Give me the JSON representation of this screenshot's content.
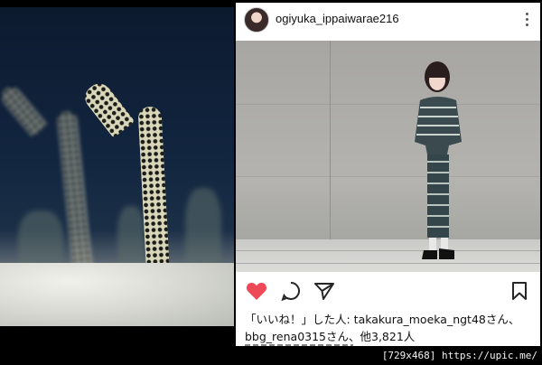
{
  "post": {
    "username": "ogiyuka_ippaiwarae216",
    "likes_line1": "「いいね！」した人: takakura_moeka_ngt48さん、",
    "likes_line2": "bbg_rena0315さん、他3,821人"
  },
  "icons": {
    "more": "more-vertical-icon",
    "like": "heart-icon",
    "comment": "comment-icon",
    "share": "send-icon",
    "save": "bookmark-icon"
  },
  "colors": {
    "like": "#ed4956"
  },
  "watermark": "[729x468] https://upic.me/"
}
